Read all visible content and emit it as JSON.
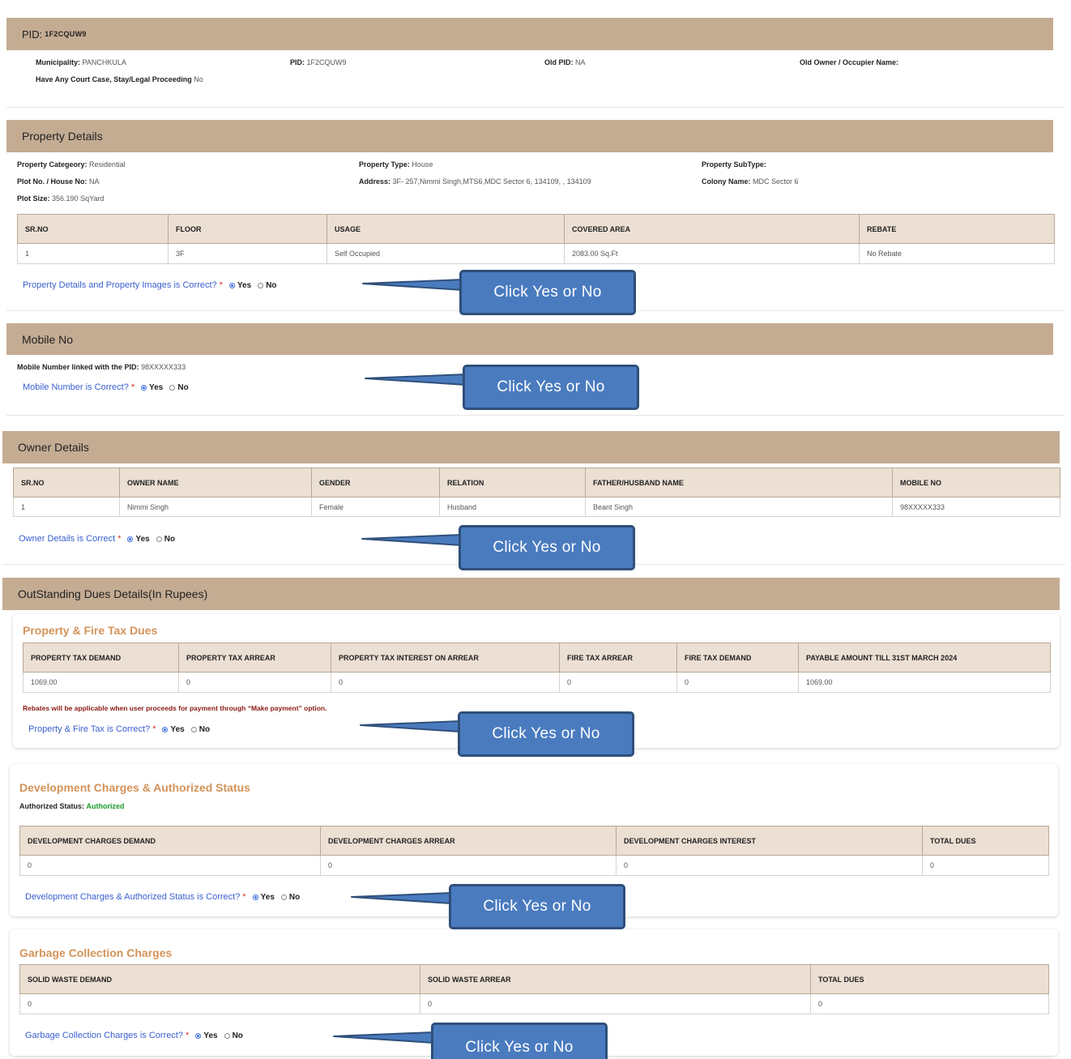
{
  "pid_section": {
    "header_label": "PID:",
    "header_value": "1F2CQUW9",
    "municipality_label": "Municipality:",
    "municipality_value": "PANCHKULA",
    "pid_label": "PID:",
    "pid_value": "1F2CQUW9",
    "old_pid_label": "Old PID:",
    "old_pid_value": "NA",
    "old_owner_label": "Old Owner / Occupier Name:",
    "court_label": "Have Any Court Case, Stay/Legal Proceeding",
    "court_value": "No"
  },
  "property": {
    "title": "Property Details",
    "category_label": "Property Categeory:",
    "category_value": "Residential",
    "type_label": "Property Type:",
    "type_value": "House",
    "subtype_label": "Property SubType:",
    "plot_label": "Plot No. / House No:",
    "plot_value": "NA",
    "address_label": "Address:",
    "address_value": "3F- 257,Nimmi Singh,MTS6,MDC Sector 6, 134109, , 134109",
    "colony_label": "Colony Name:",
    "colony_value": "MDC Sector 6",
    "size_label": "Plot Size:",
    "size_value": "356.190 SqYard",
    "table": {
      "headers": [
        "SR.NO",
        "FLOOR",
        "USAGE",
        "COVERED AREA",
        "REBATE"
      ],
      "rows": [
        [
          "1",
          "3F",
          "Self Occupied",
          "2083.00 Sq.Ft",
          "No Rebate"
        ]
      ]
    },
    "question": "Property Details and Property Images is Correct?"
  },
  "mobile": {
    "title": "Mobile No",
    "linked_label": "Mobile Number linked with the PID:",
    "linked_value": "98XXXXX333",
    "question": "Mobile Number is Correct?"
  },
  "owner": {
    "title": "Owner Details",
    "table": {
      "headers": [
        "SR.NO",
        "OWNER NAME",
        "GENDER",
        "RELATION",
        "FATHER/HUSBAND NAME",
        "MOBILE NO"
      ],
      "rows": [
        [
          "1",
          "Nimmi Singh",
          "Female",
          "Husband",
          "Beant Singh",
          "98XXXXX333"
        ]
      ]
    },
    "question": "Owner Details is Correct"
  },
  "dues": {
    "title": "OutStanding Dues Details(In Rupees)",
    "fire": {
      "title": "Property & Fire Tax Dues",
      "table": {
        "headers": [
          "PROPERTY TAX DEMAND",
          "PROPERTY TAX ARREAR",
          "PROPERTY TAX INTEREST ON ARREAR",
          "FIRE TAX ARREAR",
          "FIRE TAX DEMAND",
          "PAYABLE AMOUNT TILL 31ST MARCH 2024"
        ],
        "rows": [
          [
            "1069.00",
            "0",
            "0",
            "0",
            "0",
            "1069.00"
          ]
        ]
      },
      "note": "Rebates will be applicable when user proceeds for payment through “Make payment” option.",
      "question": "Property & Fire Tax is Correct?"
    },
    "dev": {
      "title": "Development Charges & Authorized Status",
      "auth_label": "Authorized Status:",
      "auth_value": "Authorized",
      "table": {
        "headers": [
          "DEVELOPMENT CHARGES DEMAND",
          "DEVELOPMENT CHARGES ARREAR",
          "DEVELOPMENT CHARGES INTEREST",
          "TOTAL DUES"
        ],
        "rows": [
          [
            "0",
            "0",
            "0",
            "0"
          ]
        ]
      },
      "question": "Development Charges & Authorized Status is Correct?"
    },
    "garbage": {
      "title": "Garbage Collection Charges",
      "table": {
        "headers": [
          "SOLID WASTE DEMAND",
          "SOLID WASTE ARREAR",
          "TOTAL DUES"
        ],
        "rows": [
          [
            "0",
            "0",
            "0"
          ]
        ]
      },
      "question": "Garbage Collection Charges is Correct?"
    }
  },
  "radio": {
    "yes": "Yes",
    "no": "No",
    "required_mark": "*"
  },
  "callout_text": "Click Yes or No",
  "colors": {
    "header_bg": "#c4ac93",
    "table_header_bg": "#ecdfd3",
    "question_blue": "#3a5fcf",
    "sub_title_orange": "#d4935a",
    "callout_blue": "#4a7bbf",
    "authorized_green": "#1a9a2a"
  }
}
